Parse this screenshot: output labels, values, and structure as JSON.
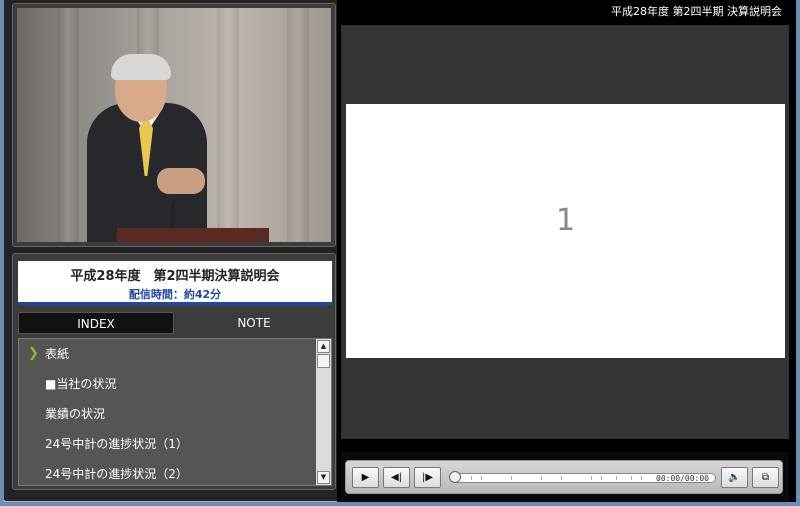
{
  "header": {
    "title": "平成28年度 第2四半期 決算説明会"
  },
  "event": {
    "title": "平成28年度　第2四半期決算説明会",
    "duration": "配信時間：約42分"
  },
  "tabs": [
    {
      "label": "INDEX",
      "active": true
    },
    {
      "label": "NOTE",
      "active": false
    }
  ],
  "index_items": [
    {
      "label": "表紙",
      "current": true,
      "marker": "chevron-right-icon"
    },
    {
      "label": "■当社の状況",
      "current": false
    },
    {
      "label": "業績の状況",
      "current": false
    },
    {
      "label": "24号中計の進捗状況（1）",
      "current": false
    },
    {
      "label": "24号中計の進捗状況（2）",
      "current": false
    }
  ],
  "slide": {
    "number": "1"
  },
  "player": {
    "time": "00:00/00:00",
    "buttons": [
      "play-icon",
      "previous-icon",
      "next-icon",
      "volume-icon",
      "popout-icon"
    ],
    "progress": 0
  },
  "colors": {
    "accent_blue": "#1f47a8",
    "chevron_green": "#7ec331",
    "list_bg": "#555555"
  }
}
